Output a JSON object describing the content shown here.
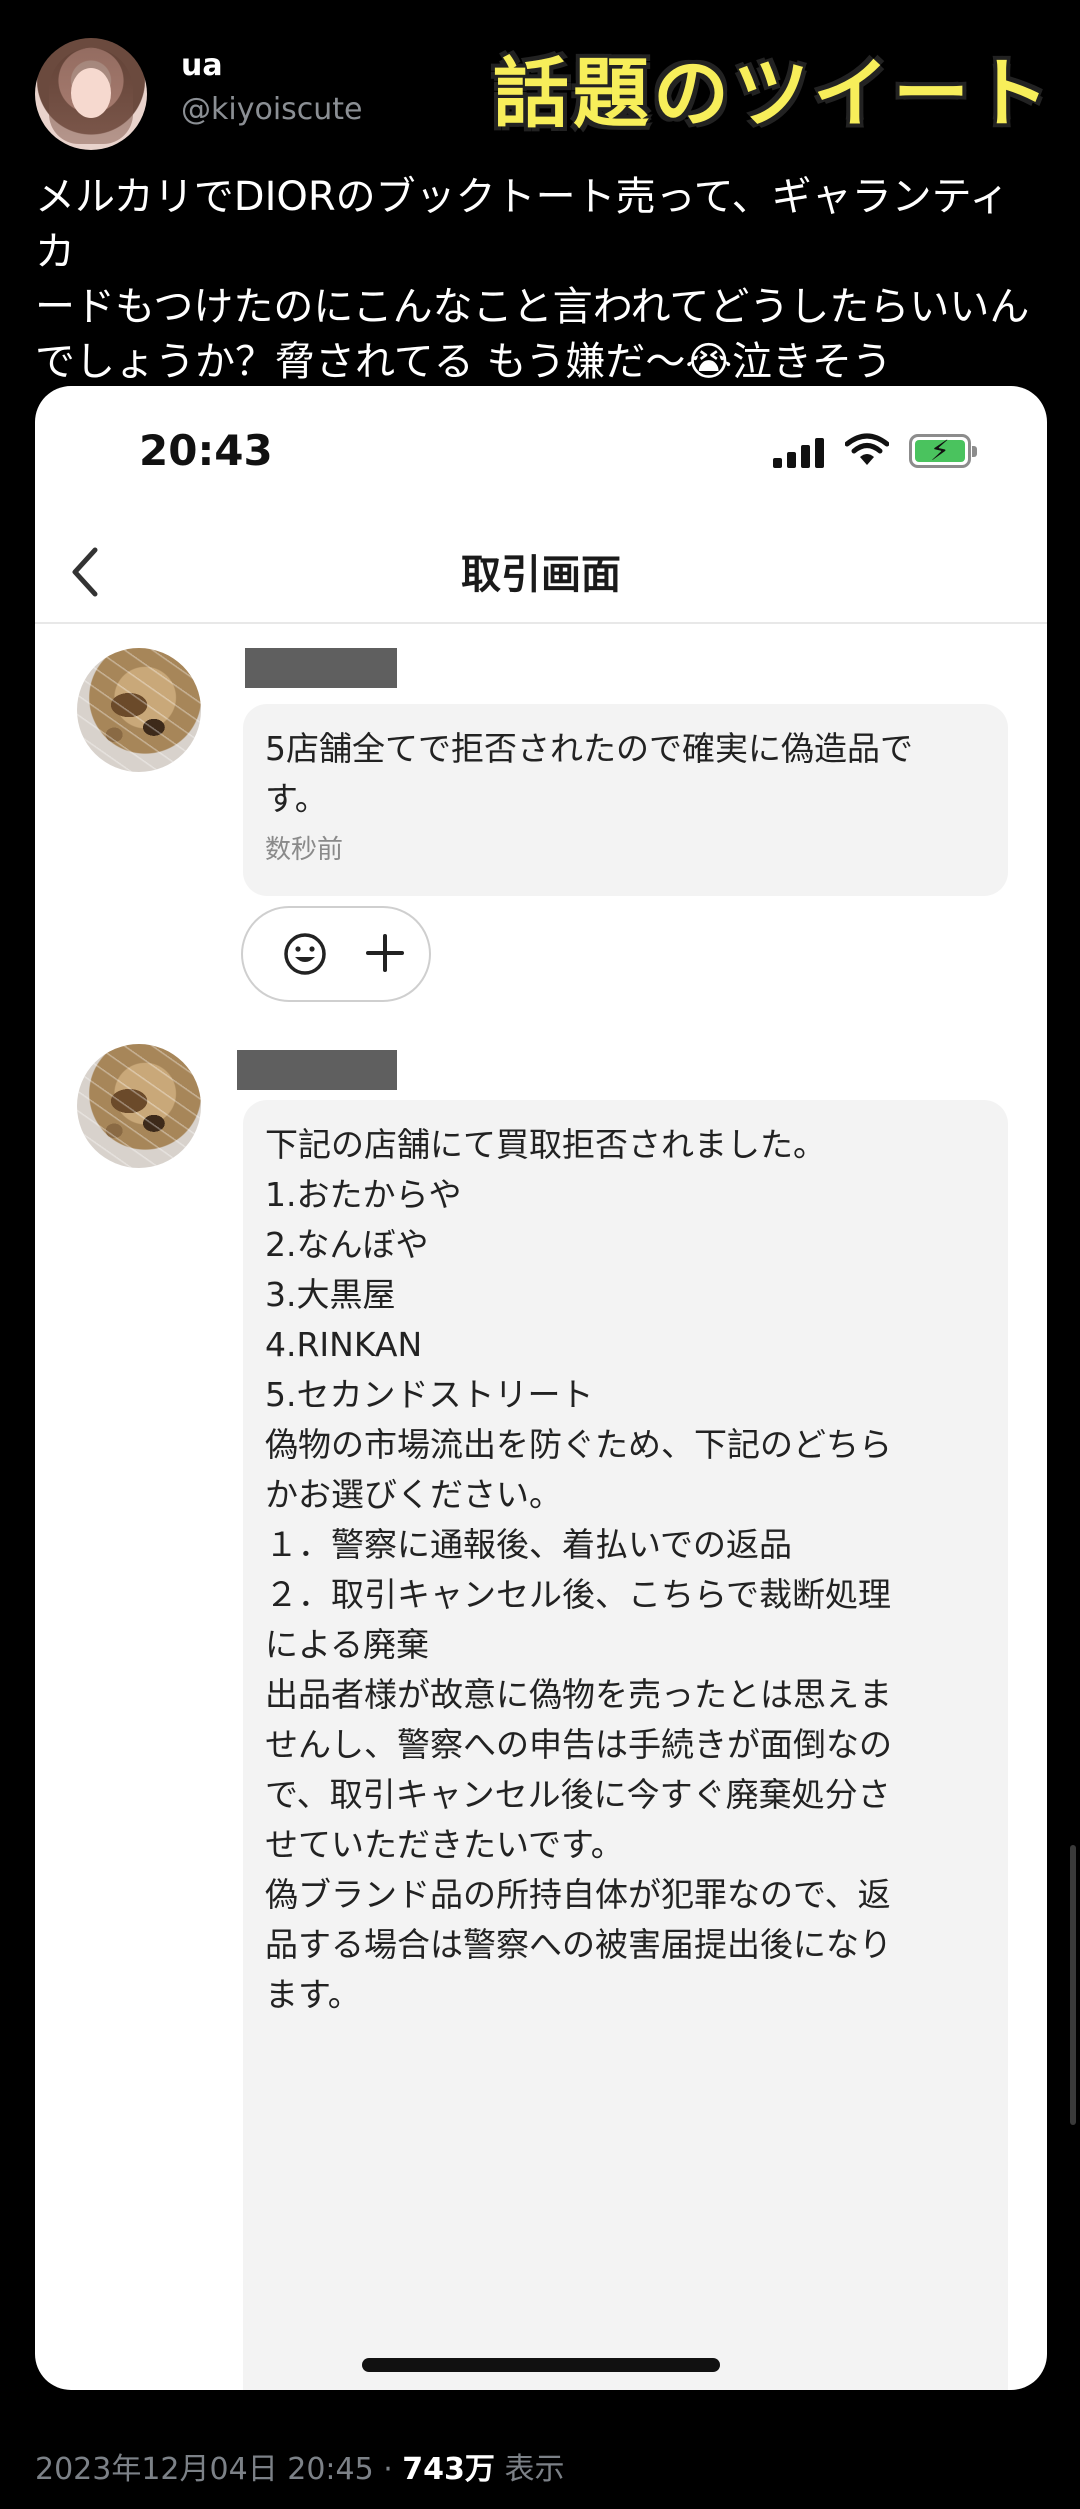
{
  "tweet": {
    "display_name": "ua",
    "handle": "@kiyoiscute",
    "banner": "話題のツイート",
    "text_lines": [
      "メルカリでDIORのブックトート売って、ギャランティカ",
      "ードもつけたのにこんなこと言われてどうしたらいいん",
      "でしょうか？脅されてる もう嫌だ〜😭泣きそう"
    ],
    "timestamp": "2023年12月04日 20:45",
    "separator": " · ",
    "views_count": "743万",
    "views_label": " 表示"
  },
  "screenshot": {
    "status_time": "20:43",
    "nav_title": "取引画面",
    "messages": [
      {
        "lines": [
          "5店舗全てで拒否されたので確実に偽造品で",
          "す。"
        ],
        "time": "数秒前"
      },
      {
        "lines": [
          "下記の店舗にて買取拒否されました。",
          "1.おたからや",
          "2.なんぼや",
          "3.大黒屋",
          "4.RINKAN",
          "5.セカンドストリート",
          "",
          "",
          "偽物の市場流出を防ぐため、下記のどちら",
          "かお選びください。",
          "",
          "１．警察に通報後、着払いでの返品",
          "",
          "２．取引キャンセル後、こちらで裁断処理",
          "による廃棄",
          "",
          "出品者様が故意に偽物を売ったとは思えま",
          "せんし、警察への申告は手続きが面倒なの",
          "で、取引キャンセル後に今すぐ廃棄処分さ",
          "せていただきたいです。",
          "",
          "偽ブランド品の所持自体が犯罪なので、返",
          "品する場合は警察への被害届提出後になり",
          "ます。"
        ]
      }
    ]
  },
  "colors": {
    "background": "#000000",
    "banner_text": "#f7ee5a",
    "muted_text": "#7c8187",
    "bubble_bg": "#f3f3f3",
    "battery_green": "#4ac35e"
  },
  "icons": [
    "back-chevron-icon",
    "signal-icon",
    "wifi-icon",
    "battery-charging-icon",
    "smile-icon",
    "plus-icon"
  ]
}
